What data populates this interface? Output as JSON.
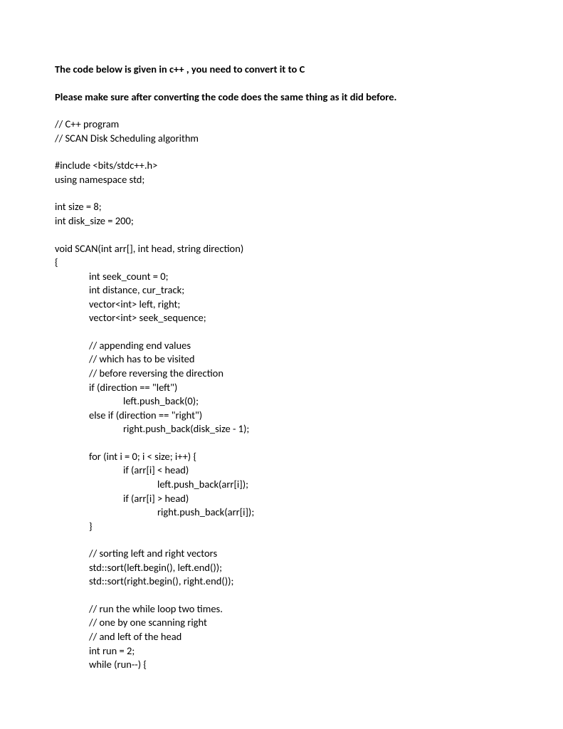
{
  "heading1": "The code below is given in c++ , you need to convert it to C",
  "heading2": "Please make sure after converting the code does the same thing as it did before.",
  "code": {
    "l01": "// C++ program",
    "l02": "// SCAN Disk Scheduling algorithm",
    "l03": "#include <bits/stdc++.h>",
    "l04": "using namespace std;",
    "l05": "int size = 8;",
    "l06": "int disk_size = 200;",
    "l07": "void SCAN(int arr[], int head, string direction)",
    "l08": "{",
    "l09": "int seek_count = 0;",
    "l10": "int distance, cur_track;",
    "l11": "vector<int> left, right;",
    "l12": "vector<int> seek_sequence;",
    "l13": "// appending end values",
    "l14": "// which has to be visited",
    "l15": "// before reversing the direction",
    "l16": "if (direction == \"left\")",
    "l17": "left.push_back(0);",
    "l18": "else if (direction == \"right\")",
    "l19": "right.push_back(disk_size - 1);",
    "l20": "for (int i = 0; i < size; i++) {",
    "l21": "if (arr[i] < head)",
    "l22": "left.push_back(arr[i]);",
    "l23": "if (arr[i] > head)",
    "l24": "right.push_back(arr[i]);",
    "l25": "}",
    "l26": "// sorting left and right vectors",
    "l27": "std::sort(left.begin(), left.end());",
    "l28": "std::sort(right.begin(), right.end());",
    "l29": "// run the while loop two times.",
    "l30": "// one by one scanning right",
    "l31": "// and left of the head",
    "l32": "int run = 2;",
    "l33": "while (run--) {"
  }
}
